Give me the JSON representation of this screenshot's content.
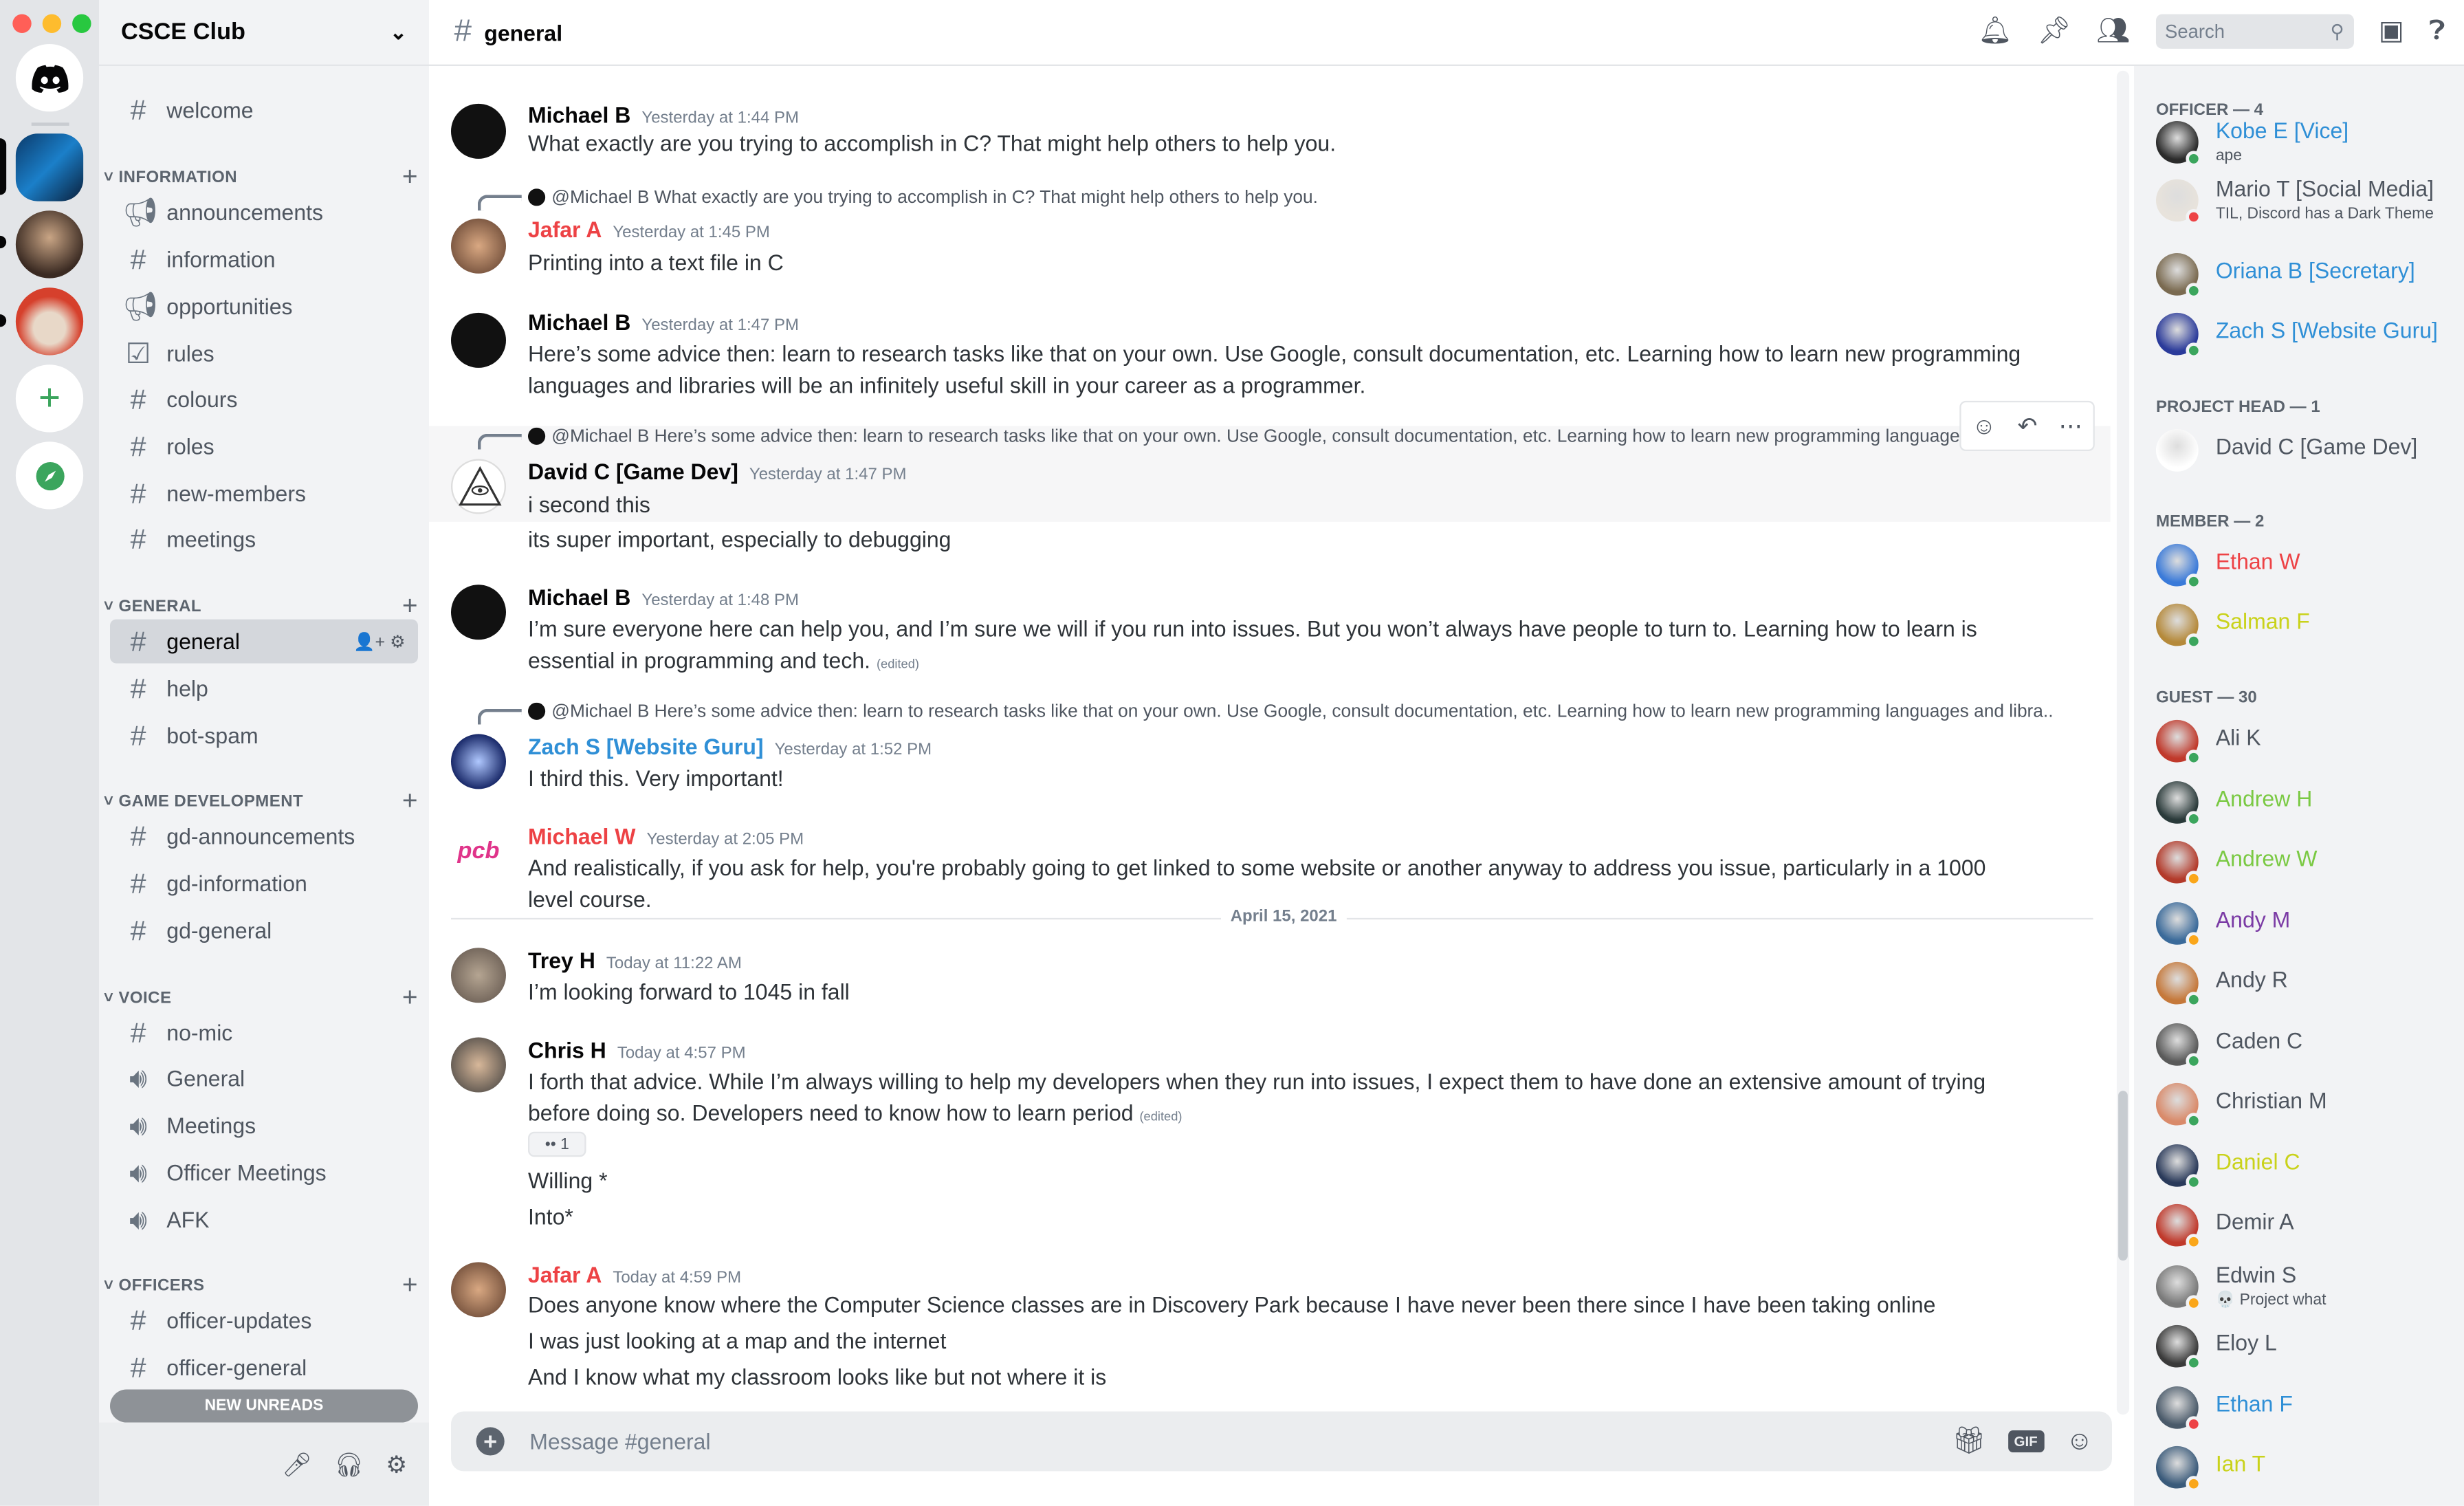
{
  "server": {
    "name": "CSCE Club"
  },
  "sidebar": {
    "top_channels": [
      {
        "label": "welcome"
      }
    ],
    "categories": [
      {
        "label": "INFORMATION",
        "channels": [
          {
            "label": "announcements",
            "icon": "megaphone-icon"
          },
          {
            "label": "information",
            "icon": "hash-icon"
          },
          {
            "label": "opportunities",
            "icon": "megaphone-icon"
          },
          {
            "label": "rules",
            "icon": "checkbox-icon"
          },
          {
            "label": "colours",
            "icon": "hash-icon"
          },
          {
            "label": "roles",
            "icon": "hash-icon"
          },
          {
            "label": "new-members",
            "icon": "hash-icon"
          },
          {
            "label": "meetings",
            "icon": "hash-icon"
          }
        ]
      },
      {
        "label": "GENERAL",
        "channels": [
          {
            "label": "general",
            "icon": "hash-icon"
          },
          {
            "label": "help",
            "icon": "hash-icon"
          },
          {
            "label": "bot-spam",
            "icon": "hash-icon"
          }
        ]
      },
      {
        "label": "GAME DEVELOPMENT",
        "channels": [
          {
            "label": "gd-announcements",
            "icon": "hash-icon"
          },
          {
            "label": "gd-information",
            "icon": "hash-icon"
          },
          {
            "label": "gd-general",
            "icon": "hash-icon"
          }
        ]
      },
      {
        "label": "VOICE",
        "channels": [
          {
            "label": "no-mic",
            "icon": "hash-icon"
          },
          {
            "label": "General",
            "icon": "speaker-icon"
          },
          {
            "label": "Meetings",
            "icon": "speaker-icon"
          },
          {
            "label": "Officer Meetings",
            "icon": "speaker-icon"
          },
          {
            "label": "AFK",
            "icon": "speaker-icon"
          }
        ]
      },
      {
        "label": "OFFICERS",
        "channels": [
          {
            "label": "officer-updates",
            "icon": "hash-icon"
          },
          {
            "label": "officer-general",
            "icon": "hash-icon"
          }
        ]
      }
    ],
    "new_unreads": "NEW UNREADS"
  },
  "header": {
    "channel": "general",
    "search_placeholder": "Search"
  },
  "messages": [
    {
      "author": "Michael B",
      "time": "Yesterday at 1:44 PM",
      "text": "What exactly are you trying to accomplish in C? That might help others to help you.",
      "color": "#060607"
    },
    {
      "reply": "@Michael B What exactly are you trying to accomplish in C? That might help others to help you.",
      "author": "Jafar A",
      "time": "Yesterday at 1:45 PM",
      "text": "Printing into a text file in C",
      "color": "#ed4245"
    },
    {
      "author": "Michael B",
      "time": "Yesterday at 1:47 PM",
      "text": "Here’s some advice then: learn to research tasks like that on your own. Use Google, consult documentation, etc. Learning how to learn new programming languages and libraries will be an infinitely useful skill in your career as a programmer.",
      "color": "#060607"
    },
    {
      "reply": "@Michael B Here’s some advice then: learn to research tasks like that on your own. Use Google, consult documentation, etc. Learning how to learn new programming languages and libraries will be an infinitely useful skill in your career as a programmer.",
      "author": "David C [Game Dev]",
      "time": "Yesterday at 1:47 PM",
      "text": "i second this",
      "followup": "its super important, especially to debugging",
      "color": "#060607"
    },
    {
      "author": "Michael B",
      "time": "Yesterday at 1:48 PM",
      "text": "I’m sure everyone here can help you, and I’m sure we will if you run into issues. But you won’t always have people to turn to. Learning how to learn is essential in programming and tech.",
      "edited": "(edited)",
      "color": "#060607"
    },
    {
      "reply": "@Michael B Here’s some advice then: learn to research tasks like that on your own. Use Google, consult documentation, etc. Learning how to learn new programming languages and libra...",
      "author": "Zach S [Website Guru]",
      "time": "Yesterday at 1:52 PM",
      "text": "I third this. Very important!",
      "color": "#2f8fd6"
    },
    {
      "author": "Michael W",
      "time": "Yesterday at 2:05 PM",
      "text": "And realistically, if you ask for help, you're probably going to get linked to some website or another anyway to address you issue, particularly in a 1000 level course.",
      "color": "#ed4245"
    },
    {
      "author": "Trey H",
      "time": "Today at 11:22 AM",
      "text": "I’m looking forward to 1045 in fall",
      "color": "#060607"
    },
    {
      "author": "Chris H",
      "time": "Today at 4:57 PM",
      "text": "I forth that advice. While I’m always willing to help my developers when they run into issues, I expect them to have done an extensive amount of trying before doing so. Developers need to know how to learn period",
      "edited": "(edited)",
      "reaction": "1",
      "followups": [
        "Willing *",
        "Into*"
      ],
      "color": "#060607"
    },
    {
      "author": "Jafar A",
      "time": "Today at 4:59 PM",
      "text": "Does anyone know where the Computer Science classes are in Discovery Park because I have never been there since I have been taking online",
      "followups": [
        "I was just looking at a map and the internet",
        "And I know what my classroom looks like but not where it is"
      ],
      "color": "#ed4245"
    }
  ],
  "date_divider": "April 15, 2021",
  "composer": {
    "placeholder": "Message #general",
    "gif": "GIF"
  },
  "members": {
    "groups": [
      {
        "label": "OFFICER — 4",
        "people": [
          {
            "name": "Kobe E [Vice]",
            "sub": "ape",
            "color": "#2f8fd6",
            "status": "#3ba55d"
          },
          {
            "name": "Mario T [Social Media]",
            "sub": "TIL, Discord has a Dark Theme",
            "color": "#4f5660",
            "status": "#ed4245"
          },
          {
            "name": "Oriana B [Secretary]",
            "sub": "",
            "color": "#2f8fd6",
            "status": "#3ba55d"
          },
          {
            "name": "Zach S [Website Guru]",
            "sub": "",
            "color": "#2f8fd6",
            "status": "#3ba55d"
          }
        ]
      },
      {
        "label": "PROJECT HEAD — 1",
        "people": [
          {
            "name": "David C [Game Dev]",
            "sub": "",
            "color": "#4f5660",
            "status": ""
          }
        ]
      },
      {
        "label": "MEMBER — 2",
        "people": [
          {
            "name": "Ethan W",
            "sub": "",
            "color": "#ed4245",
            "status": "#3ba55d"
          },
          {
            "name": "Salman F",
            "sub": "",
            "color": "#c9d21a",
            "status": "#3ba55d"
          }
        ]
      },
      {
        "label": "GUEST — 30",
        "people": [
          {
            "name": "Ali K",
            "sub": "",
            "color": "#4f5660",
            "status": "#3ba55d"
          },
          {
            "name": "Andrew H",
            "sub": "",
            "color": "#7ac943",
            "status": "#3ba55d"
          },
          {
            "name": "Andrew W",
            "sub": "",
            "color": "#7ac943",
            "status": "#faa61a"
          },
          {
            "name": "Andy M",
            "sub": "",
            "color": "#7b3ba5",
            "status": "#faa61a"
          },
          {
            "name": "Andy R",
            "sub": "",
            "color": "#4f5660",
            "status": "#3ba55d"
          },
          {
            "name": "Caden C",
            "sub": "",
            "color": "#4f5660",
            "status": "#3ba55d"
          },
          {
            "name": "Christian M",
            "sub": "",
            "color": "#4f5660",
            "status": "#3ba55d"
          },
          {
            "name": "Daniel C",
            "sub": "",
            "color": "#c9d21a",
            "status": "#3ba55d"
          },
          {
            "name": "Demir A",
            "sub": "",
            "color": "#4f5660",
            "status": "#faa61a"
          },
          {
            "name": "Edwin S",
            "sub": "💀 Project what",
            "color": "#4f5660",
            "status": "#faa61a"
          },
          {
            "name": "Eloy L",
            "sub": "",
            "color": "#4f5660",
            "status": "#3ba55d"
          },
          {
            "name": "Ethan F",
            "sub": "",
            "color": "#2f8fd6",
            "status": "#ed4245"
          },
          {
            "name": "Ian T",
            "sub": "",
            "color": "#c9d21a",
            "status": "#faa61a"
          }
        ]
      }
    ]
  }
}
